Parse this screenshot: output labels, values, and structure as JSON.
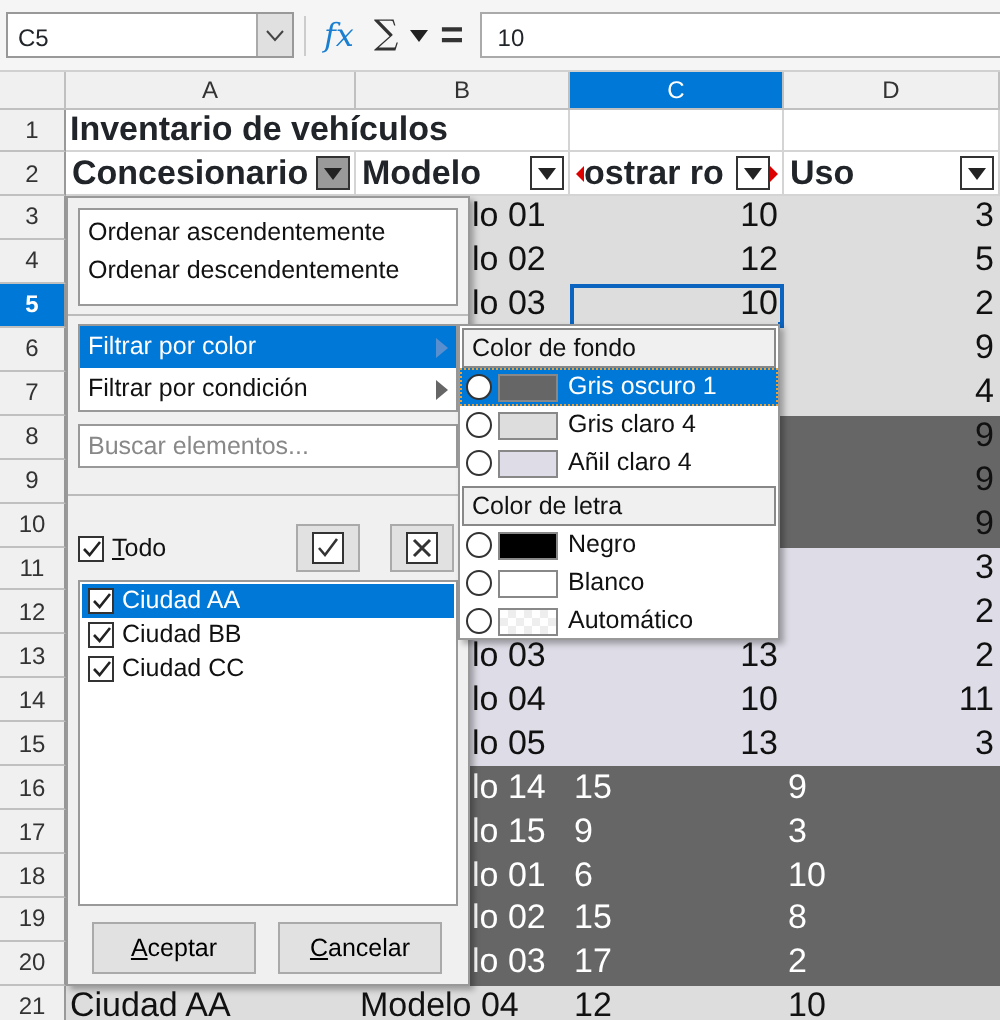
{
  "toolbar": {
    "cell_reference": "C5",
    "function_label": "fx",
    "sum_label": "∑",
    "equals_label": "=",
    "formula": "10"
  },
  "columns": [
    {
      "label": "A",
      "selected": false
    },
    {
      "label": "B",
      "selected": false
    },
    {
      "label": "C",
      "selected": true
    },
    {
      "label": "D",
      "selected": false
    }
  ],
  "title_row": {
    "number": "1",
    "selected": false,
    "text": "Inventario de vehículos"
  },
  "header_row": {
    "number": "2",
    "selected": false,
    "cells": [
      {
        "text": "Concesionario",
        "filter_open": true,
        "overflow": false
      },
      {
        "text": "Modelo",
        "filter_open": false,
        "overflow": false
      },
      {
        "text": "ostrar ro",
        "filter_open": false,
        "overflow": true
      },
      {
        "text": "Uso",
        "filter_open": false,
        "overflow": false
      }
    ]
  },
  "rows": [
    {
      "number": "3",
      "selected": false,
      "color": "#dddddd",
      "light_text": false,
      "left_aligned": false,
      "partly_hidden": true,
      "b": "lo 01",
      "c": "10",
      "d": "3"
    },
    {
      "number": "4",
      "selected": false,
      "color": "#dddddd",
      "light_text": false,
      "left_aligned": false,
      "partly_hidden": true,
      "b": "lo 02",
      "c": "12",
      "d": "5"
    },
    {
      "number": "5",
      "selected": true,
      "color": "#dddddd",
      "light_text": false,
      "left_aligned": false,
      "partly_hidden": true,
      "b": "lo 03",
      "c": "10",
      "d": "2"
    },
    {
      "number": "6",
      "selected": false,
      "color": "#dddddd",
      "light_text": false,
      "left_aligned": false,
      "d": "9"
    },
    {
      "number": "7",
      "selected": false,
      "color": "#dddddd",
      "light_text": false,
      "left_aligned": false,
      "d": "4"
    },
    {
      "number": "8",
      "selected": false,
      "color": "#666666",
      "light_text": false,
      "left_aligned": false,
      "d": "9"
    },
    {
      "number": "9",
      "selected": false,
      "color": "#666666",
      "light_text": false,
      "left_aligned": false,
      "d": "9"
    },
    {
      "number": "10",
      "selected": false,
      "color": "#666666",
      "light_text": false,
      "left_aligned": false,
      "d": "9"
    },
    {
      "number": "11",
      "selected": false,
      "color": "#dedce6",
      "light_text": false,
      "left_aligned": false,
      "d": "3"
    },
    {
      "number": "12",
      "selected": false,
      "color": "#dedce6",
      "light_text": false,
      "left_aligned": false,
      "d": "2"
    },
    {
      "number": "13",
      "selected": false,
      "color": "#dedce6",
      "light_text": false,
      "left_aligned": false,
      "partly_hidden": true,
      "b": "lo 03",
      "c": "13",
      "d": "2"
    },
    {
      "number": "14",
      "selected": false,
      "color": "#dedce6",
      "light_text": false,
      "left_aligned": false,
      "partly_hidden": true,
      "b": "lo 04",
      "c": "10",
      "d": "11"
    },
    {
      "number": "15",
      "selected": false,
      "color": "#dedce6",
      "light_text": false,
      "left_aligned": false,
      "partly_hidden": true,
      "b": "lo 05",
      "c": "13",
      "d": "3"
    },
    {
      "number": "16",
      "selected": false,
      "color": "#666666",
      "light_text": true,
      "left_aligned": true,
      "partly_hidden": true,
      "b": "lo 14",
      "c": "15",
      "d": "9"
    },
    {
      "number": "17",
      "selected": false,
      "color": "#666666",
      "light_text": true,
      "left_aligned": true,
      "partly_hidden": true,
      "b": "lo 15",
      "c": "9",
      "d": "3"
    },
    {
      "number": "18",
      "selected": false,
      "color": "#666666",
      "light_text": true,
      "left_aligned": true,
      "partly_hidden": true,
      "b": "lo 01",
      "c": "6",
      "d": "10"
    },
    {
      "number": "19",
      "selected": false,
      "color": "#666666",
      "light_text": true,
      "left_aligned": true,
      "partly_hidden": true,
      "b": "lo 02",
      "c": "15",
      "d": "8"
    },
    {
      "number": "20",
      "selected": false,
      "color": "#666666",
      "light_text": true,
      "left_aligned": true,
      "partly_hidden": true,
      "b": "lo 03",
      "c": "17",
      "d": "2"
    },
    {
      "number": "21",
      "selected": false,
      "color": "#dddddd",
      "light_text": false,
      "left_aligned": true,
      "partly_hidden": false,
      "a": "Ciudad AA",
      "b": "Modelo 04",
      "c": "12",
      "d": "10"
    }
  ],
  "filter_menu": {
    "sort_items": [
      "Ordenar ascendentemente",
      "Ordenar descendentemente"
    ],
    "filter_items": [
      {
        "label": "Filtrar por color",
        "selected": true
      },
      {
        "label": "Filtrar por condición",
        "selected": false
      }
    ],
    "search_placeholder": "Buscar elementos...",
    "all": {
      "label": "Todo",
      "checked": true
    },
    "values": [
      {
        "label": "Ciudad AA",
        "checked": true,
        "selected": true
      },
      {
        "label": "Ciudad BB",
        "checked": true,
        "selected": false
      },
      {
        "label": "Ciudad CC",
        "checked": true,
        "selected": false
      }
    ],
    "buttons": [
      "Aceptar",
      "Cancelar"
    ]
  },
  "color_menu": {
    "sections": [
      {
        "title": "Color de fondo",
        "items": [
          {
            "label": "Gris oscuro 1",
            "kind": "color",
            "color": "#666666",
            "selected": true
          },
          {
            "label": "Gris claro 4",
            "kind": "color",
            "color": "#dddddd",
            "selected": false
          },
          {
            "label": "Añil claro 4",
            "kind": "color",
            "color": "#dedce6",
            "selected": false
          }
        ]
      },
      {
        "title": "Color de letra",
        "items": [
          {
            "label": "Negro",
            "kind": "color",
            "color": "#000000",
            "selected": false
          },
          {
            "label": "Blanco",
            "kind": "color",
            "color": "#ffffff",
            "selected": false
          },
          {
            "label": "Automático",
            "kind": "automatic",
            "selected": false
          }
        ]
      }
    ]
  }
}
